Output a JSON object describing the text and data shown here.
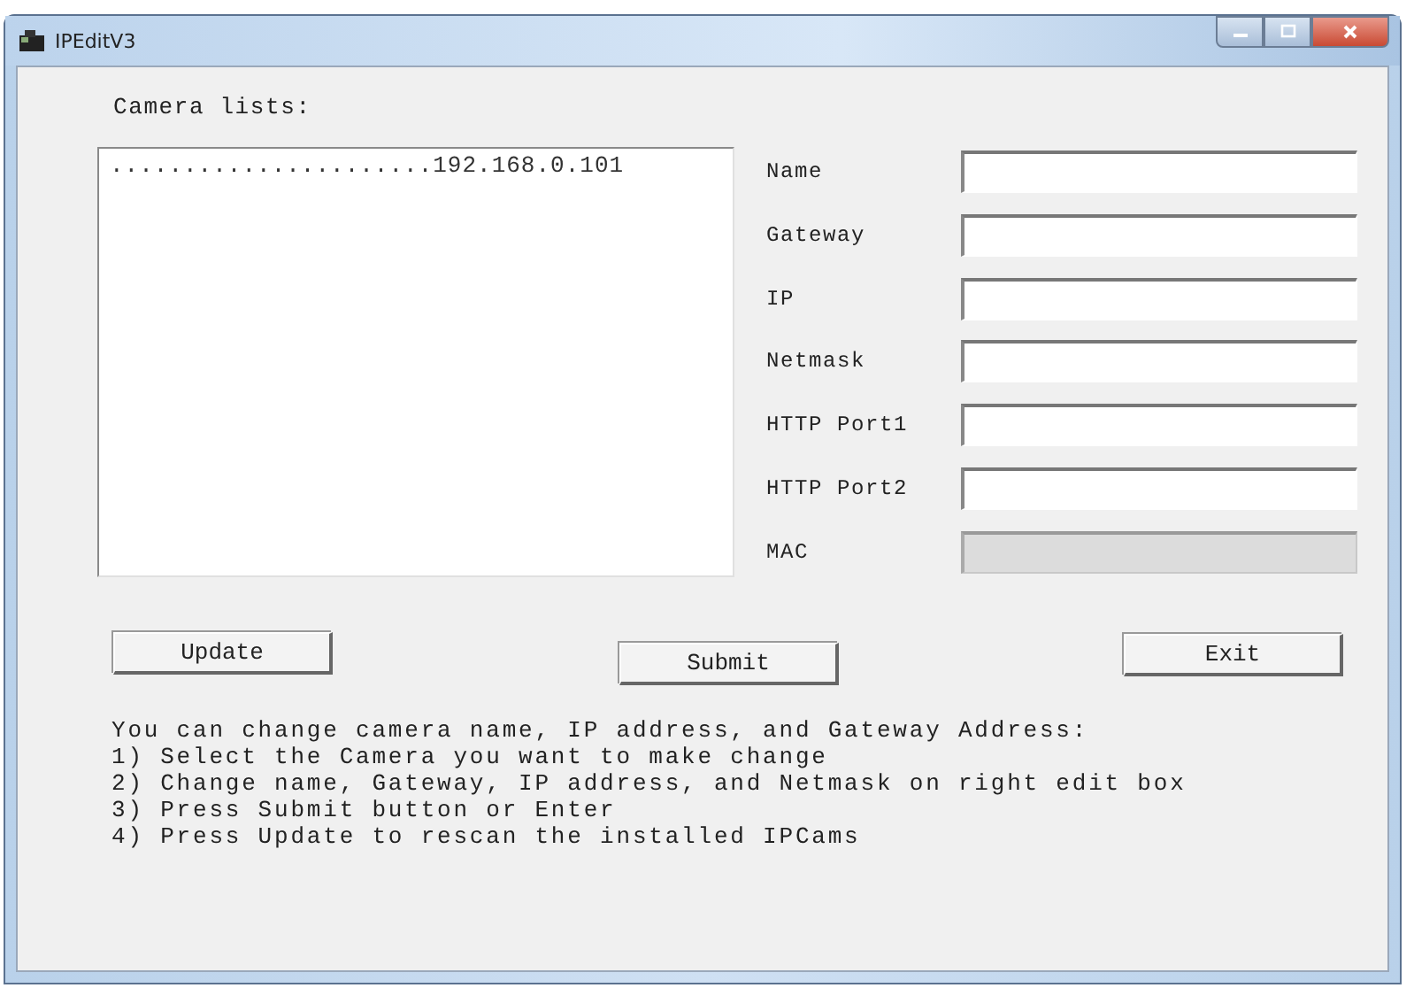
{
  "window": {
    "title": "IPEditV3"
  },
  "camera_list": {
    "label": "Camera lists:",
    "items": [
      {
        "text": "......................192.168.0.101",
        "selected": false
      }
    ]
  },
  "fields": [
    {
      "label": "Name",
      "disabled": false
    },
    {
      "label": "Gateway",
      "disabled": false
    },
    {
      "label": "IP",
      "disabled": false
    },
    {
      "label": "Netmask",
      "disabled": false
    },
    {
      "label": "HTTP Port1",
      "disabled": false
    },
    {
      "label": "HTTP Port2",
      "disabled": false
    },
    {
      "label": "MAC",
      "disabled": true
    }
  ],
  "buttons": [
    {
      "label": "Update",
      "kind": "update"
    },
    {
      "label": "Submit",
      "kind": "submit"
    },
    {
      "label": "Exit",
      "kind": "exit"
    }
  ],
  "instructions": [
    "You can change camera name, IP address, and Gateway Address:",
    "1) Select the Camera you want to make change",
    "2) Change name, Gateway, IP address, and Netmask on right edit box",
    "3) Press Submit button or Enter",
    "4) Press Update to rescan the installed IPCams"
  ]
}
